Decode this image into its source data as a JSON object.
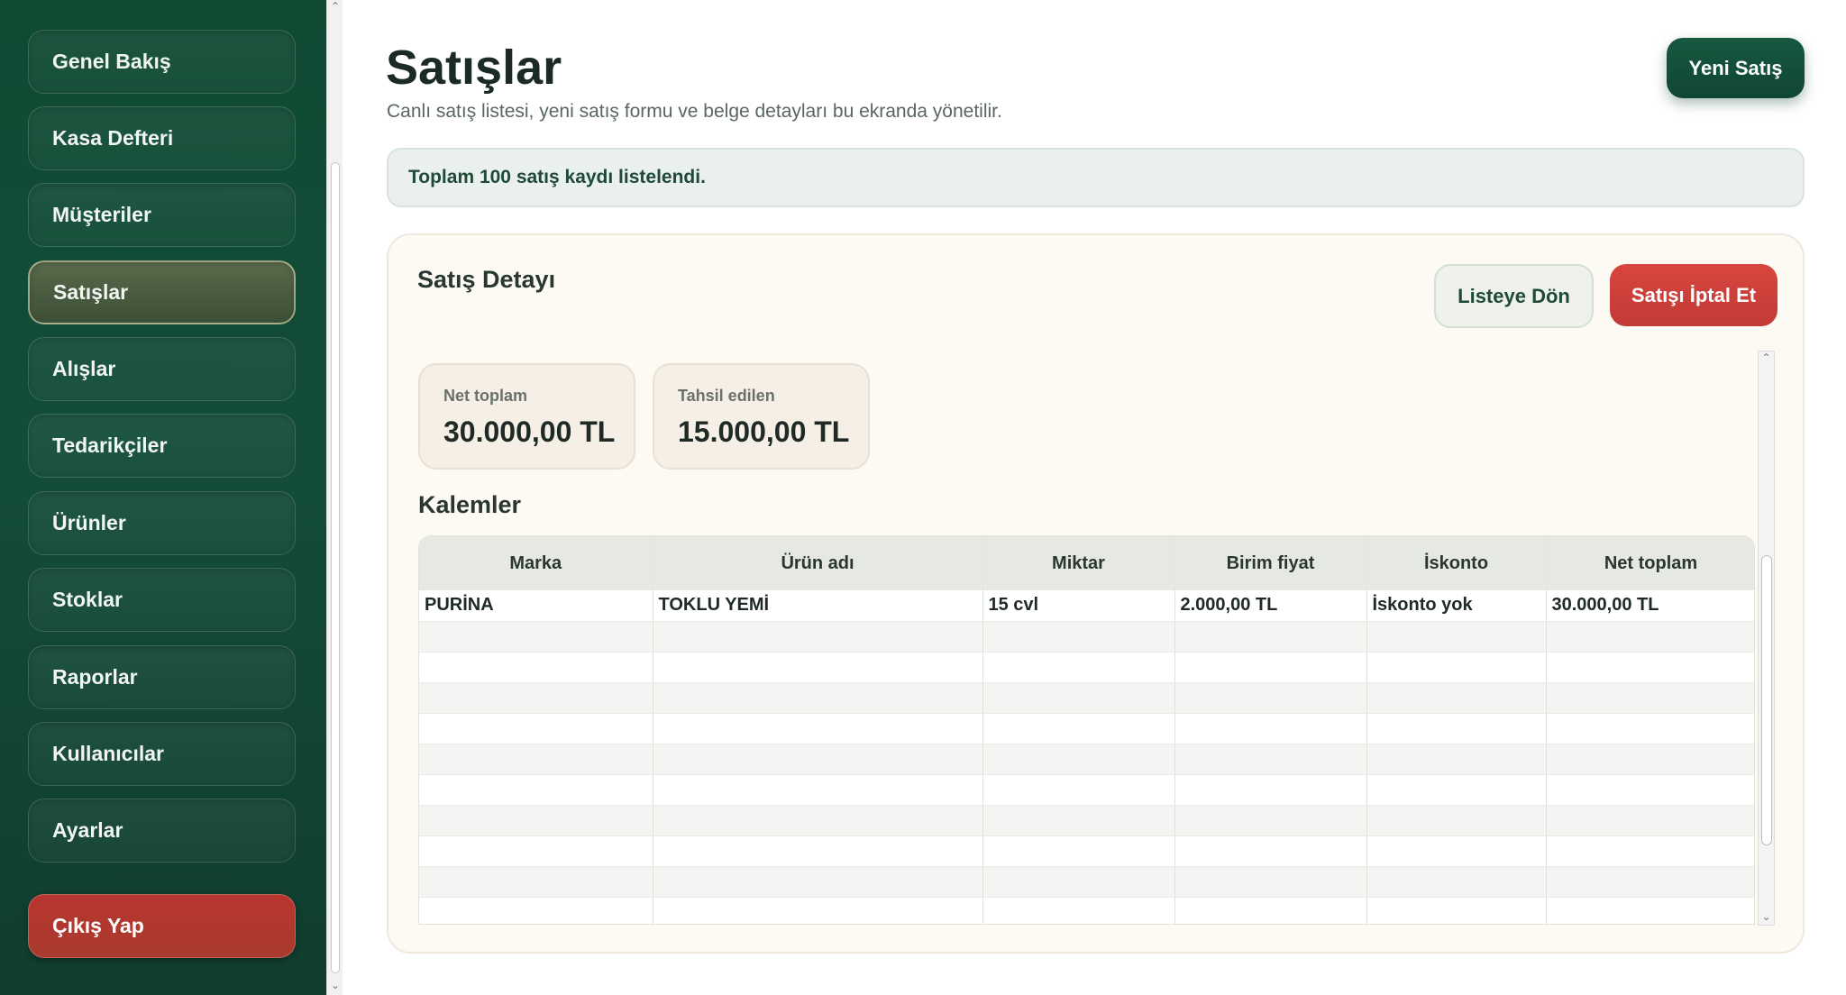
{
  "sidebar": {
    "items": [
      {
        "label": "Genel Bakış"
      },
      {
        "label": "Kasa Defteri"
      },
      {
        "label": "Müşteriler"
      },
      {
        "label": "Satışlar"
      },
      {
        "label": "Alışlar"
      },
      {
        "label": "Tedarikçiler"
      },
      {
        "label": "Ürünler"
      },
      {
        "label": "Stoklar"
      },
      {
        "label": "Raporlar"
      },
      {
        "label": "Kullanıcılar"
      },
      {
        "label": "Ayarlar"
      }
    ],
    "active_index": 3,
    "logout_label": "Çıkış Yap"
  },
  "header": {
    "title": "Satışlar",
    "subtitle": "Canlı satış listesi, yeni satış formu ve belge detayları bu ekranda yönetilir.",
    "new_sale_label": "Yeni Satış"
  },
  "banner": {
    "text": "Toplam 100 satış kaydı listelendi."
  },
  "detail": {
    "title": "Satış Detayı",
    "back_label": "Listeye Dön",
    "cancel_label": "Satışı İptal Et",
    "stats": [
      {
        "label": "Net toplam",
        "value": "30.000,00 TL"
      },
      {
        "label": "Tahsil edilen",
        "value": "15.000,00 TL"
      }
    ],
    "items_title": "Kalemler",
    "table": {
      "columns": [
        "Marka",
        "Ürün adı",
        "Miktar",
        "Birim fiyat",
        "İskonto",
        "Net toplam"
      ],
      "rows": [
        [
          "PURİNA",
          "TOKLU YEMİ",
          "15 cvl",
          "2.000,00 TL",
          "İskonto yok",
          "30.000,00 TL"
        ]
      ],
      "empty_rows": 10
    }
  },
  "colors": {
    "sidebar_bg": "#0f4a33",
    "accent_green": "#17583f",
    "danger_red": "#c23a36",
    "card_bg": "#fdfaf4"
  }
}
